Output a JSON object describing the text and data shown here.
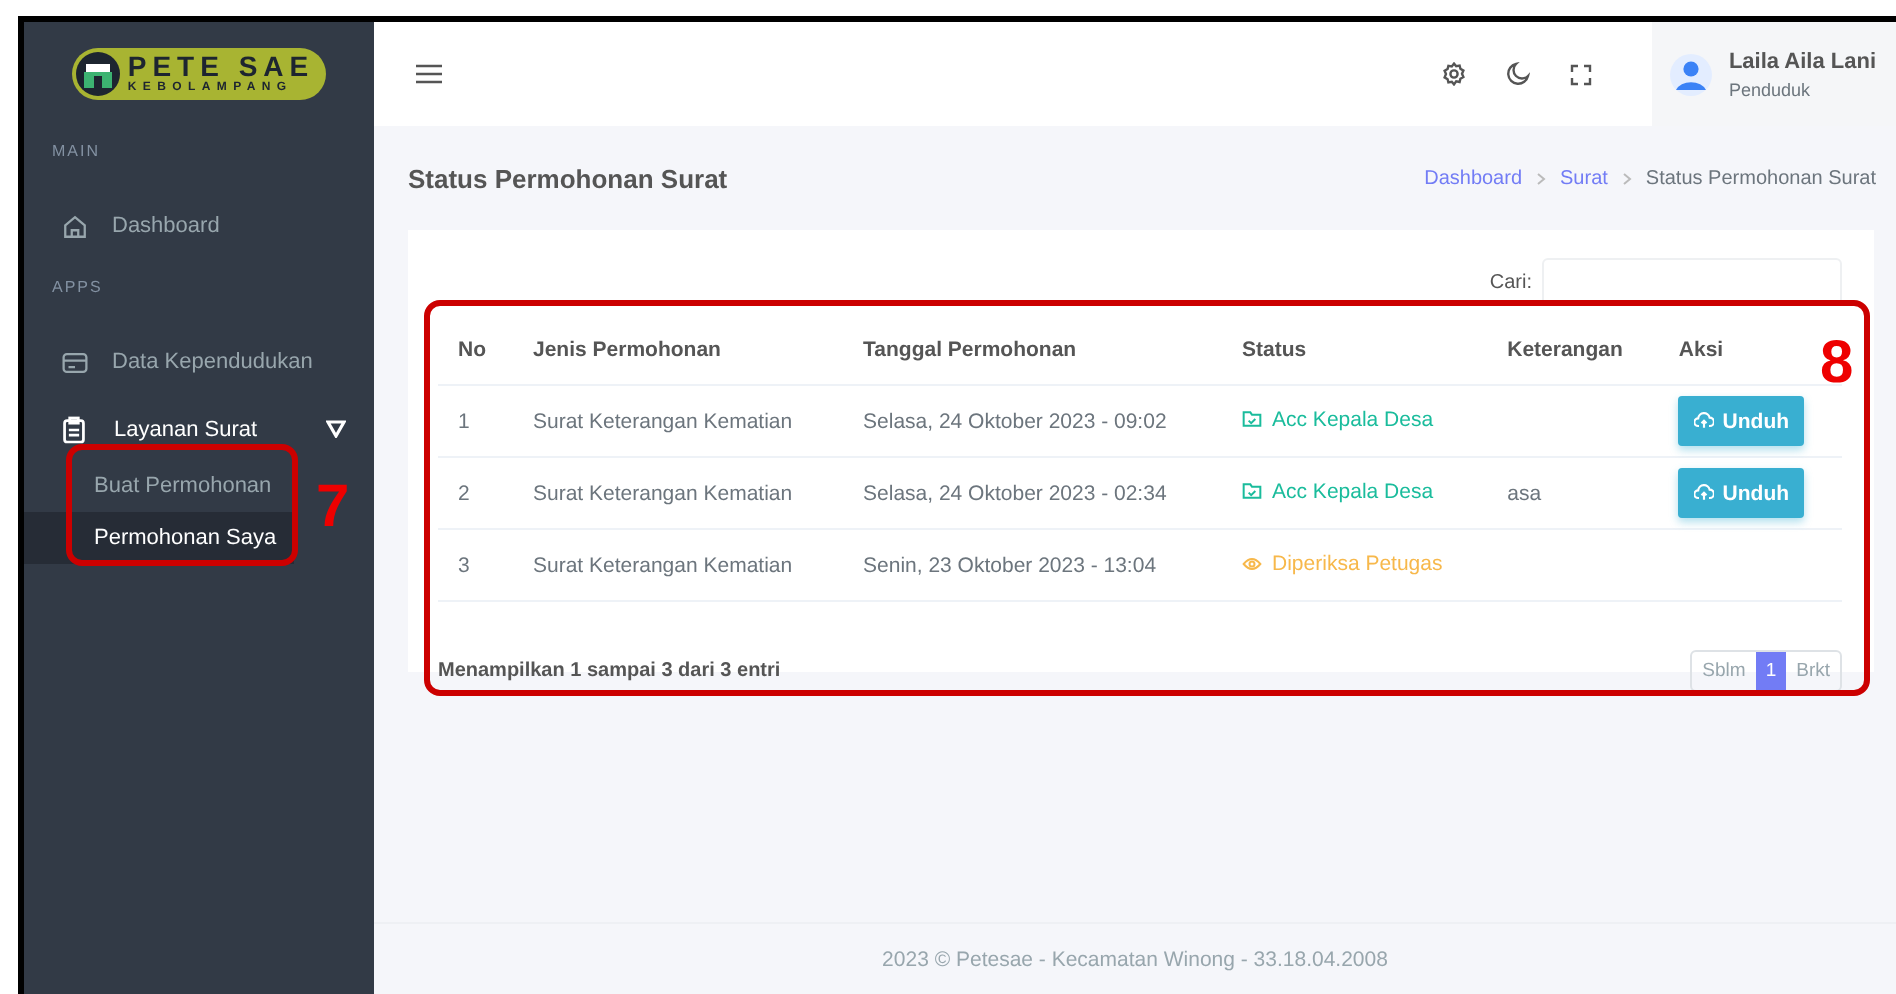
{
  "sidebar": {
    "logo": {
      "title": "PETE SAE",
      "subtitle": "KEBOLAMPANG"
    },
    "sections": [
      {
        "heading": "MAIN",
        "items": [
          {
            "label": "Dashboard"
          }
        ]
      },
      {
        "heading": "APPS",
        "items": [
          {
            "label": "Data Kependudukan"
          },
          {
            "label": "Layanan Surat",
            "expanded": true,
            "children": [
              {
                "label": "Buat Permohonan",
                "selected": false
              },
              {
                "label": "Permohonan Saya",
                "selected": true
              }
            ]
          }
        ]
      }
    ]
  },
  "topbar": {
    "user": {
      "name": "Laila Aila Lani",
      "role": "Penduduk"
    }
  },
  "page": {
    "title": "Status Permohonan Surat",
    "breadcrumbs": [
      {
        "label": "Dashboard",
        "kind": "link"
      },
      {
        "label": "Surat",
        "kind": "link"
      },
      {
        "label": "Status Permohonan Surat",
        "kind": "current"
      }
    ]
  },
  "table": {
    "search_label": "Cari:",
    "columns": [
      "No",
      "Jenis Permohonan",
      "Tanggal Permohonan",
      "Status",
      "Keterangan",
      "Aksi"
    ],
    "rows": [
      {
        "no": "1",
        "type": "Surat Keterangan Kematian",
        "date": "Selasa, 24 Oktober 2023 - 09:02",
        "status": {
          "label": "Acc Kepala Desa",
          "kind": "approved"
        },
        "action": "Unduh"
      },
      {
        "no": "2",
        "type": "Surat Keterangan Kematian",
        "date": "Selasa, 24 Oktober 2023 - 02:34",
        "status": {
          "label": "Acc Kepala Desa",
          "kind": "approved"
        },
        "note": "asa",
        "action": "Unduh"
      },
      {
        "no": "3",
        "type": "Surat Keterangan Kematian",
        "date": "Senin, 23 Oktober 2023 - 13:04",
        "status": {
          "label": "Diperiksa Petugas",
          "kind": "checking"
        }
      }
    ],
    "info": "Menampilkan 1 sampai 3 dari 3 entri",
    "pagination": {
      "prev": "Sblm",
      "pages": [
        {
          "label": "1",
          "selected": true
        }
      ],
      "next": "Brkt"
    }
  },
  "footer": "2023 © Petesae - Kecamatan Winong - 33.18.04.2008",
  "annotations": [
    {
      "label": "7"
    },
    {
      "label": "8"
    }
  ]
}
